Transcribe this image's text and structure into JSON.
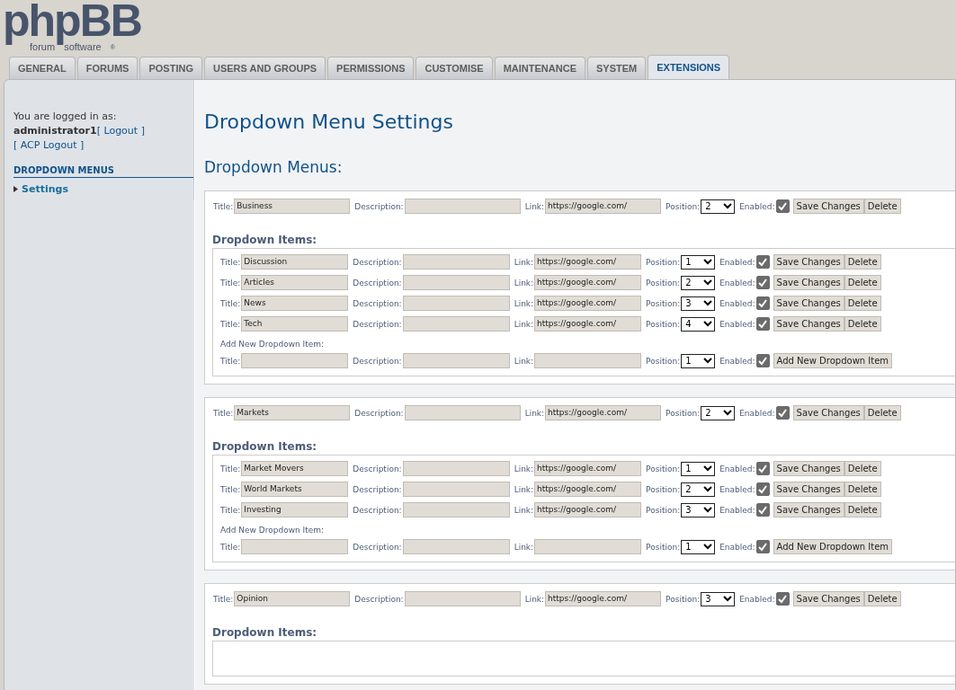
{
  "logo": {
    "word": "phpBB",
    "tagline_left": "forum",
    "tagline_right": "software",
    "mark": "®"
  },
  "tabs": [
    {
      "label": "GENERAL",
      "selected": false
    },
    {
      "label": "FORUMS",
      "selected": false
    },
    {
      "label": "POSTING",
      "selected": false
    },
    {
      "label": "USERS AND GROUPS",
      "selected": false
    },
    {
      "label": "PERMISSIONS",
      "selected": false
    },
    {
      "label": "CUSTOMISE",
      "selected": false
    },
    {
      "label": "MAINTENANCE",
      "selected": false
    },
    {
      "label": "SYSTEM",
      "selected": false
    },
    {
      "label": "EXTENSIONS",
      "selected": true
    }
  ],
  "sidebar": {
    "logged_in_text": "You are logged in as:",
    "username": "administrator1",
    "logout": "[ Logout ]",
    "acp_logout": "[ ACP Logout ]",
    "section": "DROPDOWN MENUS",
    "items": [
      {
        "label": "Settings",
        "selected": true
      }
    ]
  },
  "page_title": "Dropdown Menu Settings",
  "section_title": "Dropdown Menus:",
  "menus": [
    {
      "row": {
        "fields": [
          {
            "kind": "text",
            "label": "Title:",
            "value": "Business"
          },
          {
            "kind": "text",
            "label": "Description:"
          },
          {
            "kind": "text",
            "label": "Link:",
            "value": "https://google.com/"
          },
          {
            "kind": "select",
            "label": "Position:",
            "value": "2"
          },
          {
            "kind": "checkbox",
            "label": "Enabled:",
            "checked": true
          }
        ],
        "buttons": [
          "Save Changes",
          "Delete"
        ]
      },
      "items_heading": "Dropdown Items:",
      "items": [
        {
          "fields": [
            {
              "kind": "text",
              "label": "Title:",
              "value": "Discussion"
            },
            {
              "kind": "text",
              "label": "Description:"
            },
            {
              "kind": "text",
              "label": "Link:",
              "value": "https://google.com/"
            },
            {
              "kind": "select",
              "label": "Position:",
              "value": "1"
            },
            {
              "kind": "checkbox",
              "label": "Enabled:",
              "checked": true
            }
          ],
          "buttons": [
            "Save Changes",
            "Delete"
          ]
        },
        {
          "fields": [
            {
              "kind": "text",
              "label": "Title:",
              "value": "Articles"
            },
            {
              "kind": "text",
              "label": "Description:"
            },
            {
              "kind": "text",
              "label": "Link:",
              "value": "https://google.com/"
            },
            {
              "kind": "select",
              "label": "Position:",
              "value": "2"
            },
            {
              "kind": "checkbox",
              "label": "Enabled:",
              "checked": true
            }
          ],
          "buttons": [
            "Save Changes",
            "Delete"
          ]
        },
        {
          "fields": [
            {
              "kind": "text",
              "label": "Title:",
              "value": "News"
            },
            {
              "kind": "text",
              "label": "Description:"
            },
            {
              "kind": "text",
              "label": "Link:",
              "value": "https://google.com/"
            },
            {
              "kind": "select",
              "label": "Position:",
              "value": "3"
            },
            {
              "kind": "checkbox",
              "label": "Enabled:",
              "checked": true
            }
          ],
          "buttons": [
            "Save Changes",
            "Delete"
          ]
        },
        {
          "fields": [
            {
              "kind": "text",
              "label": "Title:",
              "value": "Tech"
            },
            {
              "kind": "text",
              "label": "Description:"
            },
            {
              "kind": "text",
              "label": "Link:",
              "value": "https://google.com/"
            },
            {
              "kind": "select",
              "label": "Position:",
              "value": "4"
            },
            {
              "kind": "checkbox",
              "label": "Enabled:",
              "checked": true
            }
          ],
          "buttons": [
            "Save Changes",
            "Delete"
          ]
        }
      ],
      "add_new": {
        "label": "Add New Dropdown Item:",
        "fields": [
          {
            "kind": "text",
            "label": "Title:"
          },
          {
            "kind": "text",
            "label": "Description:"
          },
          {
            "kind": "text",
            "label": "Link:"
          },
          {
            "kind": "select",
            "label": "Position:",
            "value": "1"
          },
          {
            "kind": "checkbox",
            "label": "Enabled:",
            "checked": true
          }
        ],
        "buttons": [
          "Add New Dropdown Item"
        ]
      }
    },
    {
      "row": {
        "fields": [
          {
            "kind": "text",
            "label": "Title:",
            "value": "Markets"
          },
          {
            "kind": "text",
            "label": "Description:"
          },
          {
            "kind": "text",
            "label": "Link:",
            "value": "https://google.com/"
          },
          {
            "kind": "select",
            "label": "Position:",
            "value": "2"
          },
          {
            "kind": "checkbox",
            "label": "Enabled:",
            "checked": true
          }
        ],
        "buttons": [
          "Save Changes",
          "Delete"
        ]
      },
      "items_heading": "Dropdown Items:",
      "items": [
        {
          "fields": [
            {
              "kind": "text",
              "label": "Title:",
              "value": "Market Movers"
            },
            {
              "kind": "text",
              "label": "Description:"
            },
            {
              "kind": "text",
              "label": "Link:",
              "value": "https://google.com/"
            },
            {
              "kind": "select",
              "label": "Position:",
              "value": "1"
            },
            {
              "kind": "checkbox",
              "label": "Enabled:",
              "checked": true
            }
          ],
          "buttons": [
            "Save Changes",
            "Delete"
          ]
        },
        {
          "fields": [
            {
              "kind": "text",
              "label": "Title:",
              "value": "World Markets"
            },
            {
              "kind": "text",
              "label": "Description:"
            },
            {
              "kind": "text",
              "label": "Link:",
              "value": "https://google.com/"
            },
            {
              "kind": "select",
              "label": "Position:",
              "value": "2"
            },
            {
              "kind": "checkbox",
              "label": "Enabled:",
              "checked": true
            }
          ],
          "buttons": [
            "Save Changes",
            "Delete"
          ]
        },
        {
          "fields": [
            {
              "kind": "text",
              "label": "Title:",
              "value": "Investing"
            },
            {
              "kind": "text",
              "label": "Description:"
            },
            {
              "kind": "text",
              "label": "Link:",
              "value": "https://google.com/"
            },
            {
              "kind": "select",
              "label": "Position:",
              "value": "3"
            },
            {
              "kind": "checkbox",
              "label": "Enabled:",
              "checked": true
            }
          ],
          "buttons": [
            "Save Changes",
            "Delete"
          ]
        }
      ],
      "add_new": {
        "label": "Add New Dropdown Item:",
        "fields": [
          {
            "kind": "text",
            "label": "Title:"
          },
          {
            "kind": "text",
            "label": "Description:"
          },
          {
            "kind": "text",
            "label": "Link:"
          },
          {
            "kind": "select",
            "label": "Position:",
            "value": "1"
          },
          {
            "kind": "checkbox",
            "label": "Enabled:",
            "checked": true
          }
        ],
        "buttons": [
          "Add New Dropdown Item"
        ]
      }
    },
    {
      "row": {
        "fields": [
          {
            "kind": "text",
            "label": "Title:",
            "value": "Opinion"
          },
          {
            "kind": "text",
            "label": "Description:"
          },
          {
            "kind": "text",
            "label": "Link:",
            "value": "https://google.com/"
          },
          {
            "kind": "select",
            "label": "Position:",
            "value": "3"
          },
          {
            "kind": "checkbox",
            "label": "Enabled:",
            "checked": true
          }
        ],
        "buttons": [
          "Save Changes",
          "Delete"
        ]
      },
      "items_heading": "Dropdown Items:"
    }
  ]
}
